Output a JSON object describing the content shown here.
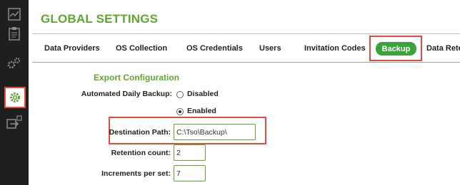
{
  "header": {
    "title": "GLOBAL SETTINGS"
  },
  "sidebar": {
    "icons": [
      "chart-icon",
      "clipboard-icon",
      "gears-icon",
      "settings-gear-icon",
      "export-icon"
    ],
    "active": "settings-gear-icon",
    "highlight_color": "#e84a3a"
  },
  "tabs": [
    {
      "label": "Data Providers"
    },
    {
      "label": "OS Collection"
    },
    {
      "label": "OS Credentials"
    },
    {
      "label": "Users"
    },
    {
      "label": "Invitation Codes"
    },
    {
      "label": "Backup",
      "active": true
    },
    {
      "label": "Data Retention"
    }
  ],
  "export": {
    "section_title": "Export Configuration",
    "daily_backup_label": "Automated Daily Backup:",
    "options": [
      {
        "label": "Disabled",
        "selected": false
      },
      {
        "label": "Enabled",
        "selected": true
      }
    ],
    "destination_label": "Destination Path:",
    "destination_value": "C:\\Tso\\Backup\\",
    "retention_label": "Retention count:",
    "retention_value": "2",
    "increments_label": "Increments per set:",
    "increments_value": "7"
  },
  "colors": {
    "accent": "#5ea82f",
    "active_tab": "#3aa33a",
    "sidebar": "#1f1f1f",
    "highlight": "#e84a3a"
  }
}
